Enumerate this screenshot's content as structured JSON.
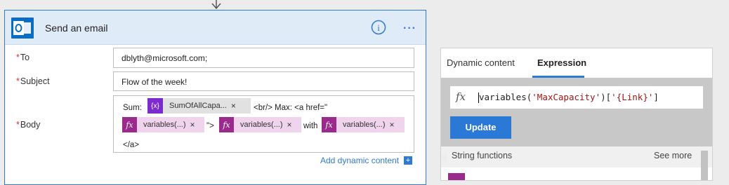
{
  "action": {
    "title": "Send an email",
    "fields": {
      "to": {
        "label": "To",
        "required_marker": "*",
        "value": "dblyth@microsoft.com;"
      },
      "subject": {
        "label": "Subject",
        "required_marker": "*",
        "value": "Flow of the week!"
      },
      "body": {
        "label": "Body",
        "required_marker": "*",
        "text_sum": "Sum:",
        "token_var": "SumOfAllCapa...",
        "text_br_max": "<br/> Max: <a href=\"",
        "token_fx_1": "variables(...)",
        "text_quote_gt": "\">",
        "token_fx_2": "variables(...)",
        "text_with": "with",
        "token_fx_3": "variables(...)",
        "text_close_a": "</a>"
      }
    },
    "add_dynamic_content": "Add dynamic content",
    "token_remove": "×",
    "more_label": "···",
    "info_symbol": "i",
    "var_icon_text": "{x}",
    "fx_symbol": "fx"
  },
  "panel": {
    "tabs": [
      {
        "label": "Dynamic content",
        "active": false
      },
      {
        "label": "Expression",
        "active": true
      }
    ],
    "expression": {
      "prefix": "variables(",
      "arg1": "'MaxCapacity'",
      "mid": ")[",
      "arg2": "'{Link}'",
      "suffix": "]"
    },
    "update_label": "Update",
    "section_title": "String functions",
    "see_more": "See more"
  },
  "colors": {
    "accent": "#2f7bd3",
    "outlook_blue": "#0a6cc3",
    "fx_purple": "#9a2a8b",
    "var_purple": "#7d2ad1",
    "required_red": "#d13438"
  }
}
